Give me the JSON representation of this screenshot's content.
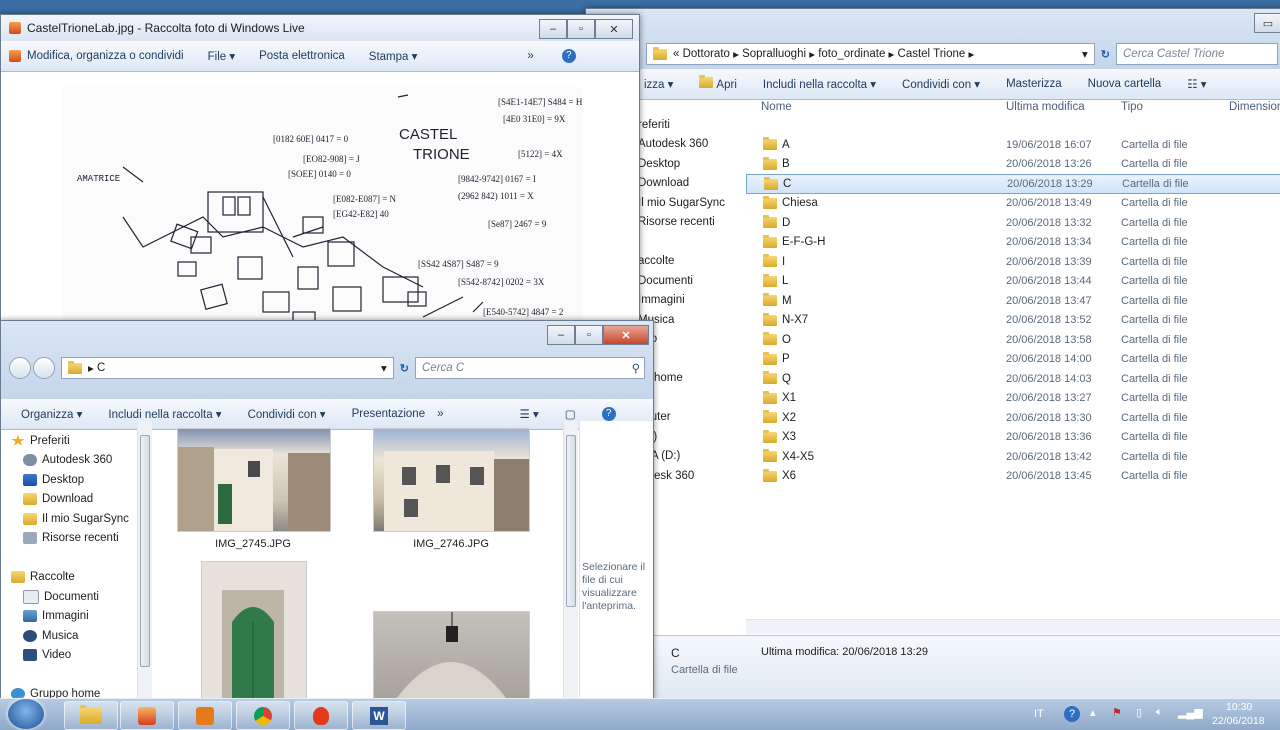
{
  "photo_viewer": {
    "title": "CastelTrioneLab.jpg - Raccolta foto di Windows Live",
    "menu": [
      "Modifica, organizza o condividi",
      "File ▾",
      "Posta elettronica",
      "Stampa ▾",
      "»"
    ],
    "sketch_text": {
      "heading": "CASTEL",
      "heading2": "TRIONE",
      "left_label": "AMATRICE"
    }
  },
  "explorer_main": {
    "breadcrumb": [
      "«",
      "Dottorato",
      "Sopralluoghi",
      "foto_ordinate",
      "Castel Trione"
    ],
    "search_placeholder": "Cerca Castel Trione",
    "toolbar": [
      "izza ▾",
      "Apri",
      "Includi nella raccolta ▾",
      "Condividi con ▾",
      "Masterizza",
      "Nuova cartella"
    ],
    "columns": {
      "name": "Nome",
      "modified": "Ultima modifica",
      "type": "Tipo",
      "size": "Dimension"
    },
    "nav": [
      "referiti",
      "Autodesk 360",
      "Desktop",
      "Download",
      "Il mio SugarSync",
      "Risorse recenti",
      "",
      "accolte",
      "Documenti",
      "Immagini",
      "Musica",
      "deo",
      "",
      "po home",
      "",
      "nputer",
      "(C:)",
      "ATA (D:)",
      "todesk 360"
    ],
    "files": [
      {
        "name": "A",
        "modified": "19/06/2018 16:07",
        "type": "Cartella di file"
      },
      {
        "name": "B",
        "modified": "20/06/2018 13:26",
        "type": "Cartella di file"
      },
      {
        "name": "C",
        "modified": "20/06/2018 13:29",
        "type": "Cartella di file",
        "selected": true
      },
      {
        "name": "Chiesa",
        "modified": "20/06/2018 13:49",
        "type": "Cartella di file"
      },
      {
        "name": "D",
        "modified": "20/06/2018 13:32",
        "type": "Cartella di file"
      },
      {
        "name": "E-F-G-H",
        "modified": "20/06/2018 13:34",
        "type": "Cartella di file"
      },
      {
        "name": "I",
        "modified": "20/06/2018 13:39",
        "type": "Cartella di file"
      },
      {
        "name": "L",
        "modified": "20/06/2018 13:44",
        "type": "Cartella di file"
      },
      {
        "name": "M",
        "modified": "20/06/2018 13:47",
        "type": "Cartella di file"
      },
      {
        "name": "N-X7",
        "modified": "20/06/2018 13:52",
        "type": "Cartella di file"
      },
      {
        "name": "O",
        "modified": "20/06/2018 13:58",
        "type": "Cartella di file"
      },
      {
        "name": "P",
        "modified": "20/06/2018 14:00",
        "type": "Cartella di file"
      },
      {
        "name": "Q",
        "modified": "20/06/2018 14:03",
        "type": "Cartella di file"
      },
      {
        "name": "X1",
        "modified": "20/06/2018 13:27",
        "type": "Cartella di file"
      },
      {
        "name": "X2",
        "modified": "20/06/2018 13:30",
        "type": "Cartella di file"
      },
      {
        "name": "X3",
        "modified": "20/06/2018 13:36",
        "type": "Cartella di file"
      },
      {
        "name": "X4-X5",
        "modified": "20/06/2018 13:42",
        "type": "Cartella di file"
      },
      {
        "name": "X6",
        "modified": "20/06/2018 13:45",
        "type": "Cartella di file"
      }
    ],
    "details": {
      "name": "C",
      "modified": "Ultima modifica: 20/06/2018 13:29",
      "type": "Cartella di file"
    }
  },
  "explorer_c": {
    "breadcrumb": "C",
    "search_placeholder": "Cerca C",
    "toolbar": [
      "Organizza ▾",
      "Includi nella raccolta ▾",
      "Condividi con ▾",
      "Presentazione",
      "»"
    ],
    "nav": [
      {
        "label": "Preferiti",
        "icon": "star-icon"
      },
      {
        "label": "Autodesk 360",
        "icon": "cloud-icon"
      },
      {
        "label": "Desktop",
        "icon": "desktop-icon"
      },
      {
        "label": "Download",
        "icon": "download-folder-icon"
      },
      {
        "label": "Il mio SugarSync",
        "icon": "folder-icon"
      },
      {
        "label": "Risorse recenti",
        "icon": "recent-icon"
      },
      {
        "label": "",
        "icon": ""
      },
      {
        "label": "Raccolte",
        "icon": "library-icon"
      },
      {
        "label": "Documenti",
        "icon": "documents-icon"
      },
      {
        "label": "Immagini",
        "icon": "pictures-icon"
      },
      {
        "label": "Musica",
        "icon": "music-icon"
      },
      {
        "label": "Video",
        "icon": "video-icon"
      },
      {
        "label": "",
        "icon": ""
      },
      {
        "label": "Gruppo home",
        "icon": "homegroup-icon"
      }
    ],
    "thumbs": [
      "IMG_2745.JPG",
      "IMG_2746.JPG"
    ],
    "preview_text": "Selezionare il file di cui visualizzare l'anteprima."
  },
  "taskbar": {
    "lang": "IT",
    "time": "10:30",
    "date": "22/06/2018",
    "apps": [
      "explorer",
      "photo-gallery",
      "media-player",
      "chrome",
      "fire-app",
      "word"
    ]
  }
}
